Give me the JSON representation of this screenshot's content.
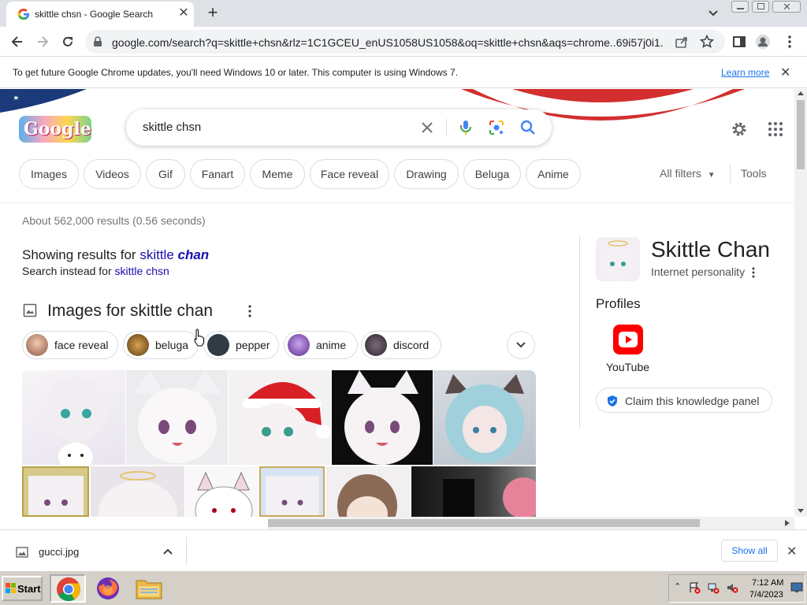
{
  "browser": {
    "tab_title": "skittle chsn - Google Search",
    "url": "google.com/search?q=skittle+chsn&rlz=1C1GCEU_enUS1058US1058&oq=skittle+chsn&aqs=chrome..69i57j0i1...",
    "infobar_message": "To get future Google Chrome updates, you'll need Windows 10 or later. This computer is using Windows 7.",
    "infobar_link": "Learn more"
  },
  "search": {
    "query": "skittle chsn",
    "logo_text": "Google",
    "chips": [
      "Images",
      "Videos",
      "Gif",
      "Fanart",
      "Meme",
      "Face reveal",
      "Drawing",
      "Beluga",
      "Anime"
    ],
    "all_filters": "All filters",
    "tools": "Tools"
  },
  "results": {
    "stats": "About 562,000 results (0.56 seconds)",
    "showing_prefix": "Showing results for",
    "showing_word1": "skittle",
    "showing_word2": "chan",
    "instead_prefix": "Search instead for",
    "instead_link": "skittle chsn",
    "images_heading": "Images for skittle chan",
    "pills": [
      "face reveal",
      "beluga",
      "pepper",
      "anime",
      "discord"
    ]
  },
  "knowledge_panel": {
    "title": "Skittle Chan",
    "subtitle": "Internet personality",
    "profiles_heading": "Profiles",
    "profile_youtube": "YouTube",
    "claim_label": "Claim this knowledge panel"
  },
  "downloads": {
    "file_name": "gucci.jpg",
    "show_all": "Show all"
  },
  "taskbar": {
    "start_label": "Start",
    "time": "7:12 AM",
    "date": "7/4/2023"
  },
  "colors": {
    "link": "#1a0dab",
    "accent_blue": "#1a73e8",
    "youtube_red": "#ff0000"
  }
}
